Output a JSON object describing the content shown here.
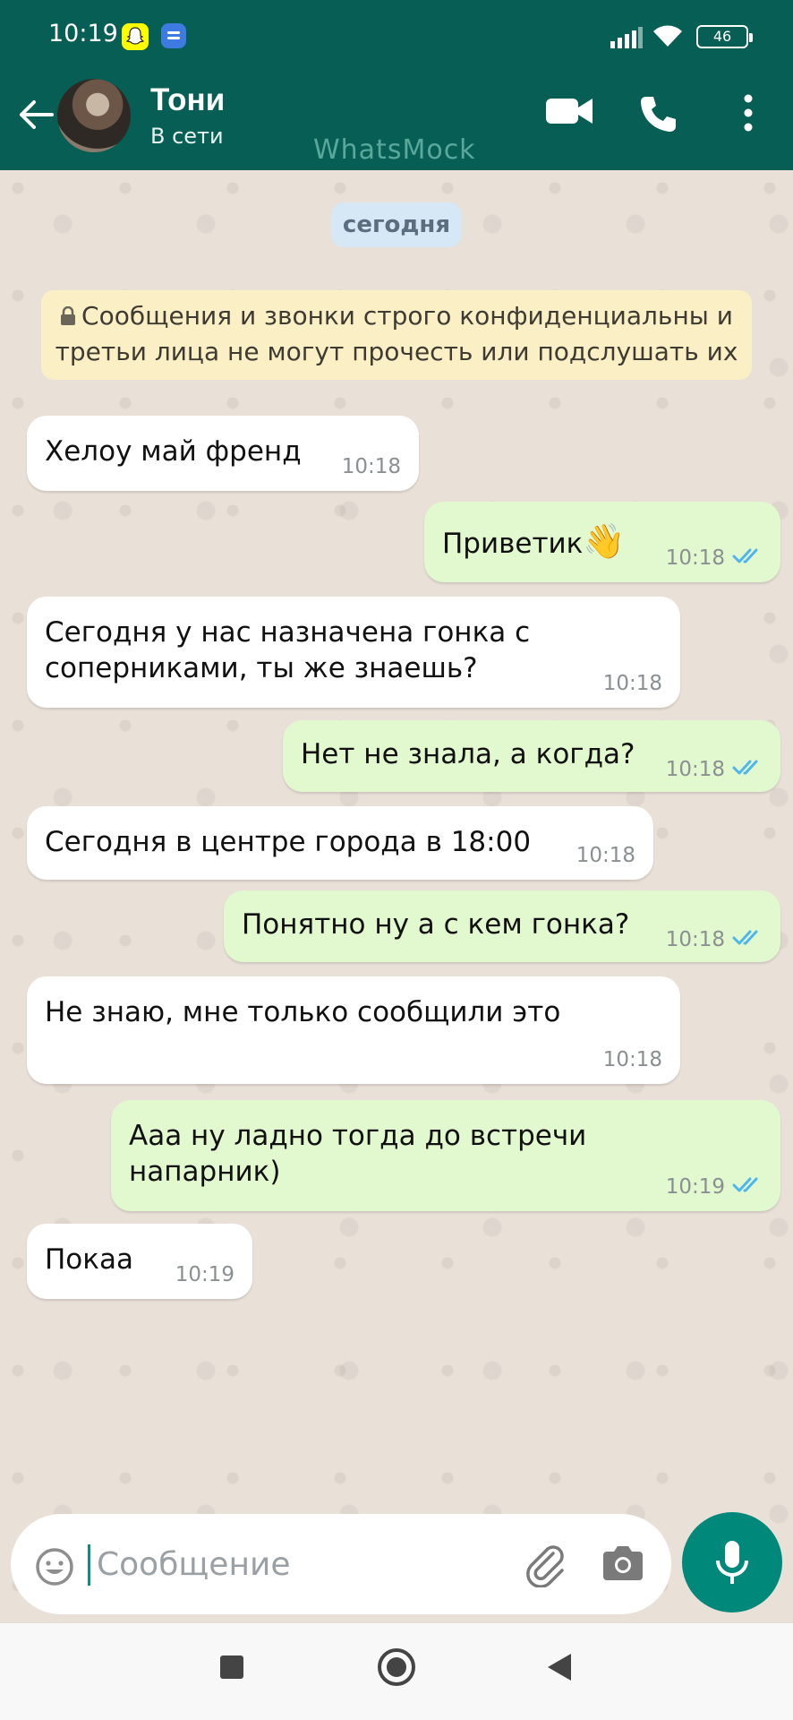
{
  "status_bar": {
    "time": "10:19",
    "battery": "46"
  },
  "header": {
    "name": "Тони",
    "presence": "В сети",
    "watermark": "WhatsMock"
  },
  "chat": {
    "date_pill": "сегодня",
    "encryption_notice": "Сообщения и звонки строго конфиденциальны и третьи лица не могут прочесть или подслушать их",
    "messages": [
      {
        "direction": "in",
        "lines": [
          "Хелоу май френд"
        ],
        "time": "10:18"
      },
      {
        "direction": "out",
        "lines": [
          "Приветик"
        ],
        "emoji": "👋",
        "time": "10:18",
        "read": true
      },
      {
        "direction": "in",
        "lines": [
          "Сегодня у нас назначена гонка с",
          "соперниками, ты же знаешь?"
        ],
        "time": "10:18"
      },
      {
        "direction": "out",
        "lines": [
          "Нет не знала, а когда?"
        ],
        "time": "10:18",
        "read": true
      },
      {
        "direction": "in",
        "lines": [
          "Сегодня в центре города в 18:00"
        ],
        "time": "10:18"
      },
      {
        "direction": "out",
        "lines": [
          "Понятно ну а с кем гонка?"
        ],
        "time": "10:18",
        "read": true
      },
      {
        "direction": "in",
        "lines": [
          "Не знаю, мне только сообщили это"
        ],
        "time": "10:18"
      },
      {
        "direction": "out",
        "lines": [
          "Ааа ну ладно тогда до встречи",
          "напарник)"
        ],
        "time": "10:19",
        "read": true
      },
      {
        "direction": "in",
        "lines": [
          "Покаа"
        ],
        "time": "10:19"
      }
    ]
  },
  "composer": {
    "placeholder": "Сообщение"
  },
  "colors": {
    "header": "#075e54",
    "incoming_bubble": "#ffffff",
    "outgoing_bubble": "#e2f8cf",
    "read_ticks": "#4fb6ec",
    "mic_button": "#00897b"
  },
  "icons": [
    "back-arrow-icon",
    "video-call-icon",
    "phone-icon",
    "more-vert-icon",
    "lock-icon",
    "emoji-icon",
    "attach-icon",
    "camera-icon",
    "mic-icon",
    "double-check-icon"
  ]
}
